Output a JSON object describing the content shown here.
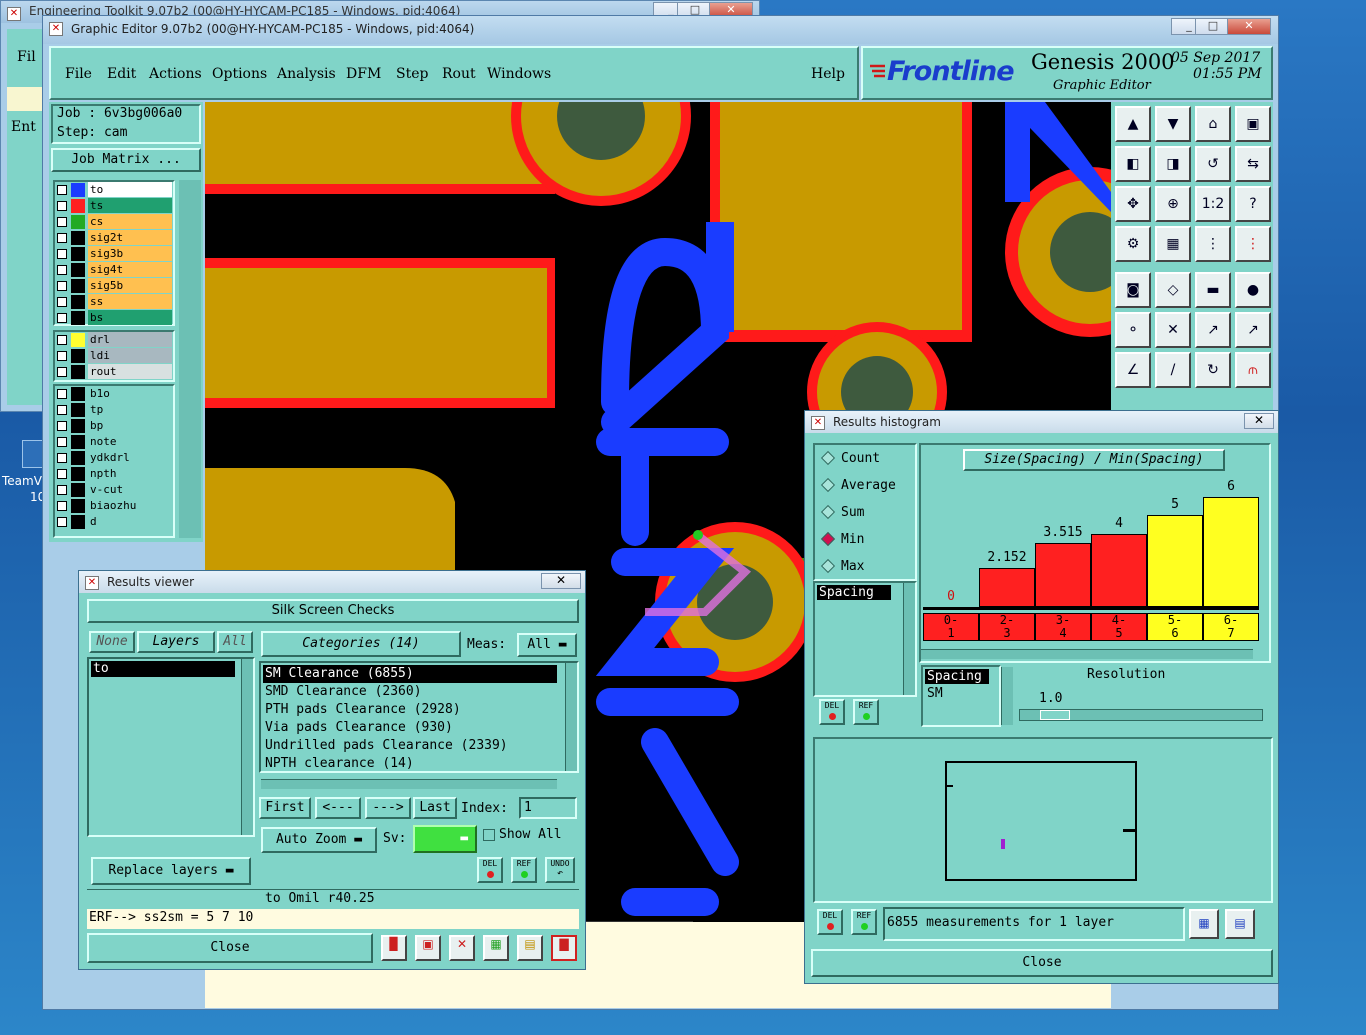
{
  "desktop": {
    "icon_label_1": "TeamV",
    "icon_label_2": "10"
  },
  "back_window": {
    "title": "Engineering Toolkit 9.07b2 (00@HY-HYCAM-PC185 - Windows, pid:4064)",
    "frag_1": "Fil",
    "frag_2": "Ent"
  },
  "main_window": {
    "title": "Graphic Editor 9.07b2 (00@HY-HYCAM-PC185 - Windows, pid:4064)",
    "controls": {
      "min": "_",
      "max": "□",
      "close": "✕"
    }
  },
  "menu": [
    "File",
    "Edit",
    "Actions",
    "Options",
    "Analysis",
    "DFM",
    "Step",
    "Rout",
    "Windows"
  ],
  "help": "Help",
  "brand": {
    "logo": "Frontline",
    "product": "Genesis 2000",
    "sub": "Graphic Editor",
    "date": "05 Sep 2017",
    "time": "01:55 PM"
  },
  "job": {
    "job_line": "Job : 6v3bg006a0",
    "step_line": "Step: cam",
    "matrix_btn": "Job Matrix ..."
  },
  "layers_group1": [
    {
      "name": "to",
      "color": "#1a3cff",
      "bg": "#ffffff"
    },
    {
      "name": "ts",
      "color": "#ff2020",
      "bg": "#20a070"
    },
    {
      "name": "cs",
      "color": "#22aa22",
      "bg": "#ffc050"
    },
    {
      "name": "sig2t",
      "color": "#000000",
      "bg": "#ffc050"
    },
    {
      "name": "sig3b",
      "color": "#000000",
      "bg": "#ffc050"
    },
    {
      "name": "sig4t",
      "color": "#000000",
      "bg": "#ffc050"
    },
    {
      "name": "sig5b",
      "color": "#000000",
      "bg": "#ffc050"
    },
    {
      "name": "ss",
      "color": "#000000",
      "bg": "#ffc050"
    },
    {
      "name": "bs",
      "color": "#000000",
      "bg": "#20a070"
    }
  ],
  "layers_group2": [
    {
      "name": "drl",
      "color": "#ffff30",
      "bg": "#a8b8c0"
    },
    {
      "name": "ldi",
      "color": "#000000",
      "bg": "#a8b8c0"
    },
    {
      "name": "rout",
      "color": "#000000",
      "bg": "#d8e0e0"
    }
  ],
  "layers_group3": [
    {
      "name": "b1o",
      "color": "#000000",
      "bg": "#80d4c8"
    },
    {
      "name": "tp",
      "color": "#000000",
      "bg": "#80d4c8"
    },
    {
      "name": "bp",
      "color": "#000000",
      "bg": "#80d4c8"
    },
    {
      "name": "note",
      "color": "#000000",
      "bg": "#80d4c8"
    },
    {
      "name": "ydkdrl",
      "color": "#000000",
      "bg": "#80d4c8"
    },
    {
      "name": "npth",
      "color": "#000000",
      "bg": "#80d4c8"
    },
    {
      "name": "v-cut",
      "color": "#000000",
      "bg": "#80d4c8"
    },
    {
      "name": "biaozhu",
      "color": "#000000",
      "bg": "#80d4c8"
    },
    {
      "name": "d",
      "color": "#000000",
      "bg": "#80d4c8"
    }
  ],
  "results_viewer": {
    "title": "Results viewer",
    "header": "Silk Screen Checks",
    "none_btn": "None",
    "layers_btn": "Layers",
    "all_btn": "All",
    "layer_list": [
      "to"
    ],
    "categories_btn": "Categories (14)",
    "meas_label": "Meas:",
    "meas_value": "All",
    "categories": [
      "SM Clearance (6855)",
      "SMD Clearance (2360)",
      "PTH pads Clearance (2928)",
      "Via pads Clearance (930)",
      "Undrilled pads Clearance (2339)",
      "NPTH clearance (14)"
    ],
    "first_btn": "First",
    "prev_btn": "<---",
    "next_btn": "--->",
    "last_btn": "Last",
    "index_label": "Index:",
    "index_value": "1",
    "autozoom_btn": "Auto Zoom",
    "sv_label": "Sv:",
    "show_all": "Show All",
    "replace_btn": "Replace layers",
    "status": "to Omil  r40.25",
    "erf": "ERF--> ss2sm = 5 7 10",
    "close_btn": "Close",
    "del": "DEL",
    "ref": "REF",
    "undo": "UNDO"
  },
  "histogram": {
    "title": "Results histogram",
    "options": [
      "Count",
      "Average",
      "Sum",
      "Min",
      "Max"
    ],
    "selected": "Min",
    "chart_title": "Size(Spacing) / Min(Spacing)",
    "list_items": [
      "Spacing"
    ],
    "spacing_label": "Spacing",
    "sm_label": "SM",
    "resolution_label": "Resolution",
    "resolution_value": "1.0",
    "summary": "6855 measurements for 1 layer",
    "close_btn": "Close",
    "del": "DEL",
    "ref": "REF"
  },
  "chart_data": {
    "type": "bar",
    "title": "Size(Spacing) / Min(Spacing)",
    "categories": [
      "0-1",
      "2-3",
      "3-4",
      "4-5",
      "5-6",
      "6-7"
    ],
    "values": [
      0,
      2.152,
      3.515,
      4,
      5,
      6
    ],
    "value_labels": [
      "0",
      "2.152",
      "3.515",
      "4",
      "5",
      "6"
    ],
    "bin_top": [
      "0-",
      "2-",
      "3-",
      "4-",
      "5-",
      "6-"
    ],
    "bin_bottom": [
      "1",
      "3",
      "4",
      "5",
      "6",
      "7"
    ],
    "colors": [
      "#ff2020",
      "#ff2020",
      "#ff2020",
      "#ff2020",
      "#ffff20",
      "#ffff20"
    ],
    "ylim": [
      0,
      6
    ]
  },
  "colors": {
    "teal": "#80d4c8",
    "pcb_gold": "#c8a000",
    "pcb_red": "#ff2020",
    "silk_blue": "#1a3cff"
  }
}
